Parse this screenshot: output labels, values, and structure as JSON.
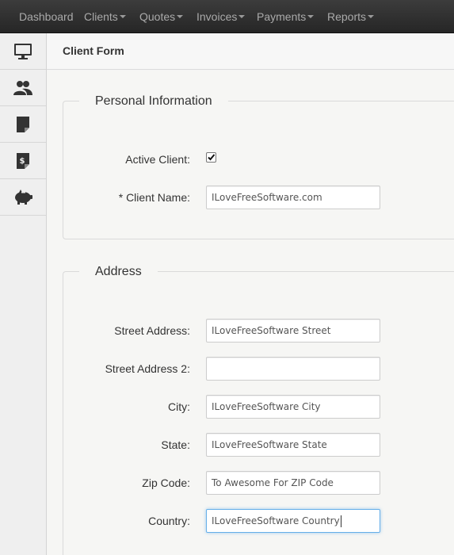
{
  "nav": {
    "items": [
      {
        "label": "Dashboard",
        "dropdown": false
      },
      {
        "label": "Clients",
        "dropdown": true
      },
      {
        "label": "Quotes",
        "dropdown": true
      },
      {
        "label": "Invoices",
        "dropdown": true
      },
      {
        "label": "Payments",
        "dropdown": true
      },
      {
        "label": "Reports",
        "dropdown": true
      }
    ]
  },
  "sidebar": {
    "icons": [
      "monitor-icon",
      "users-icon",
      "document-icon",
      "invoice-dollar-icon",
      "piggy-bank-icon"
    ]
  },
  "page": {
    "title": "Client Form"
  },
  "personal": {
    "legend": "Personal Information",
    "active_label": "Active Client:",
    "active_checked": true,
    "name_label": "* Client Name:",
    "name_value": "ILoveFreeSoftware.com"
  },
  "address": {
    "legend": "Address",
    "fields": [
      {
        "label": "Street Address:",
        "value": "ILoveFreeSoftware Street"
      },
      {
        "label": "Street Address 2:",
        "value": ""
      },
      {
        "label": "City:",
        "value": "ILoveFreeSoftware City"
      },
      {
        "label": "State:",
        "value": "ILoveFreeSoftware State"
      },
      {
        "label": "Zip Code:",
        "value": "To Awesome For ZIP Code"
      },
      {
        "label": "Country:",
        "value": "ILoveFreeSoftware Country"
      }
    ]
  },
  "colors": {
    "navbar": "#2d2d2d",
    "focus": "#66afe9"
  }
}
